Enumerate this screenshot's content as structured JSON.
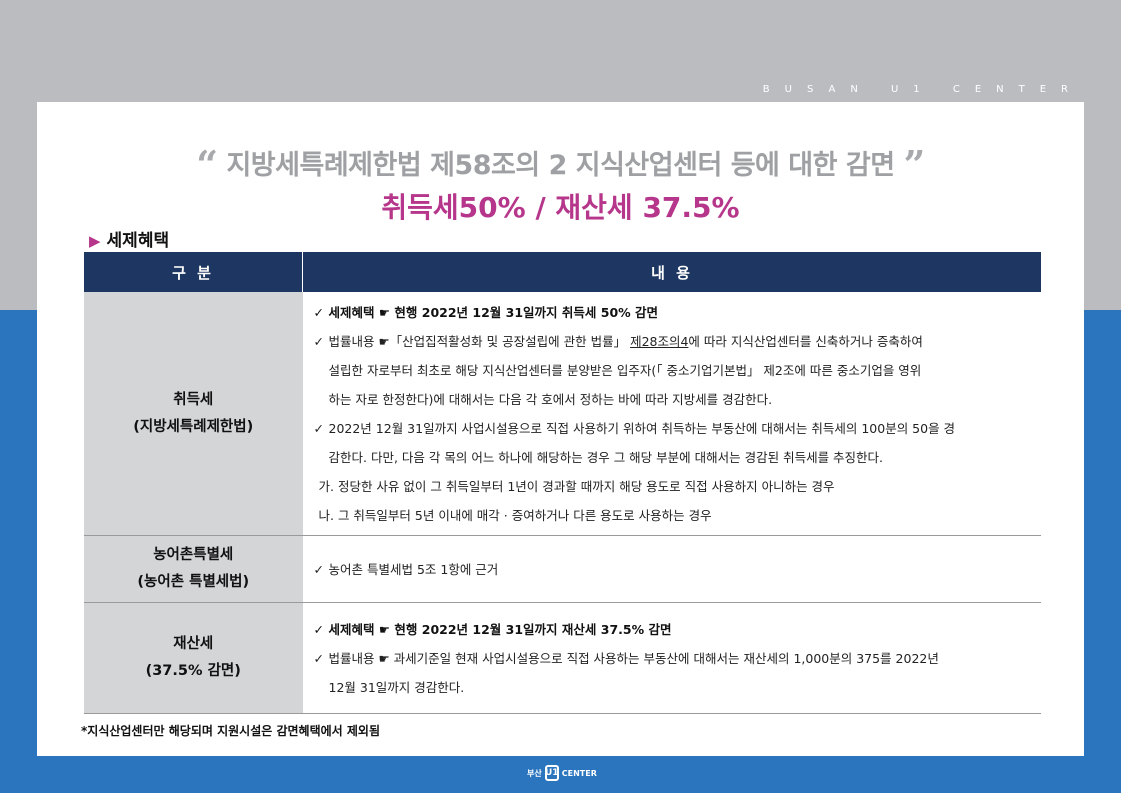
{
  "header": {
    "brand": "BUSAN U1 CENTER"
  },
  "title": {
    "open_quote": "“",
    "line1": "지방세특례제한법 제58조의 2 지식산업센터 등에 대한 감면",
    "close_quote": "”",
    "line2": "취득세50% / 재산세 37.5%"
  },
  "section": {
    "marker": "▶",
    "heading": "세제혜택"
  },
  "table": {
    "headers": [
      "구 분",
      "내 용"
    ],
    "rows": [
      {
        "category": [
          "취득세",
          "(지방세특례제한법)"
        ],
        "items": [
          "세제혜택 ☛ 현행 2022년 12월 31일까지 취득세 50% 감면",
          "법률내용 ☛「산업집적활성화 및 공장설립에 관한 법률」",
          "제28조의4",
          "에 따라 지식산업센터를 신축하거나 증축하여",
          "설립한 자로부터 최초로 해당 지식산업센터를 분양받은 입주자(「 중소기업기본법」 제2조에 따른 중소기업을 영위",
          "하는 자로 한정한다)에 대해서는 다음 각 호에서 정하는 바에 따라 지방세를 경감한다.",
          "2022년 12월 31일까지 사업시설용으로 직접 사용하기 위하여 취득하는 부동산에 대해서는 취득세의 100분의 50을 경",
          "감한다. 다만, 다음 각 목의 어느 하나에 해당하는 경우 그 해당 부분에 대해서는 경감된 취득세를 추징한다.",
          "가. 정당한 사유 없이 그 취득일부터 1년이 경과할 때까지 해당 용도로 직접 사용하지 아니하는 경우",
          "나. 그 취득일부터 5년 이내에 매각 · 증여하거나 다른 용도로 사용하는 경우"
        ]
      },
      {
        "category": [
          "농어촌특별세",
          "(농어촌 특별세법)"
        ],
        "items": [
          "농어촌 특별세법 5조 1항에 근거"
        ]
      },
      {
        "category": [
          "재산세",
          "(37.5% 감면)"
        ],
        "items": [
          "세제혜택 ☛ 현행 2022년 12월 31일까지 재산세 37.5% 감면",
          "법률내용 ☛ 과세기준일 현재 사업시설용으로 직접 사용하는 부동산에 대해서는 재산세의 1,000분의 375를 2022년",
          "12월 31일까지 경감한다."
        ]
      }
    ],
    "check": "✓"
  },
  "footnote": "*지식산업센터만 해당되며 지원시설은 감면혜택에서 제외됨",
  "footer_logo": {
    "left": "부산",
    "mark": "U1",
    "right": "CENTER"
  },
  "colors": {
    "top_band": "#bbbcc0",
    "background": "#2b75bf",
    "table_header": "#1e3762",
    "accent": "#b5368a",
    "category_cell": "#d4d5d7"
  }
}
